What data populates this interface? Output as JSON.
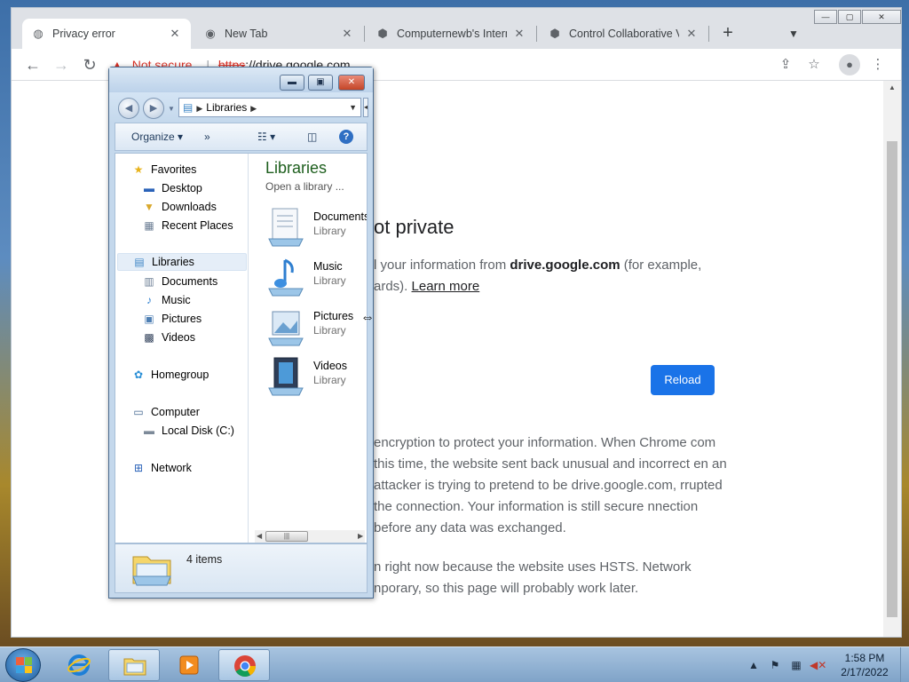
{
  "chrome": {
    "tabs": [
      {
        "label": "Privacy error",
        "icon": "globe-icon",
        "active": true
      },
      {
        "label": "New Tab",
        "icon": "chrome-icon",
        "active": false
      },
      {
        "label": "Computernewb's Interne",
        "icon": "vm-icon",
        "active": false
      },
      {
        "label": "Control Collaborative Vi",
        "icon": "vm-icon",
        "active": false
      }
    ],
    "new_tab": "+",
    "tab_search": "⌄",
    "window_controls": {
      "minimize": "—",
      "maximize": "▢",
      "close": "✕"
    },
    "url": {
      "warning": "Not secure",
      "scheme": "https",
      "host": "://drive.google.com"
    }
  },
  "page": {
    "title": "ot private",
    "para_prefix": "l your information from ",
    "para_host": "drive.google.com",
    "para_suffix": " (for example,",
    "para_line2": "ards). ",
    "learn_more": "Learn more",
    "reload": "Reload",
    "details1": "encryption to protect your information. When Chrome com this time, the website sent back unusual and incorrect en an attacker is trying to pretend to be drive.google.com, rrupted the connection. Your information is still secure nnection before any data was exchanged.",
    "details2": "n right now because the website uses HSTS. Network nporary, so this page will probably work later."
  },
  "explorer": {
    "address": "Libraries",
    "toolbar": {
      "organize": "Organize",
      "more": "»"
    },
    "nav": [
      {
        "label": "Favorites",
        "icon": "star-icon",
        "level": 0
      },
      {
        "label": "Desktop",
        "icon": "desktop-icon",
        "level": 1
      },
      {
        "label": "Downloads",
        "icon": "downloads-icon",
        "level": 1
      },
      {
        "label": "Recent Places",
        "icon": "recent-places-icon",
        "level": 1
      },
      {
        "label": "Libraries",
        "icon": "libraries-icon",
        "level": 0,
        "selected": true
      },
      {
        "label": "Documents",
        "icon": "documents-icon",
        "level": 1
      },
      {
        "label": "Music",
        "icon": "music-icon",
        "level": 1
      },
      {
        "label": "Pictures",
        "icon": "pictures-icon",
        "level": 1
      },
      {
        "label": "Videos",
        "icon": "videos-icon",
        "level": 1
      },
      {
        "label": "Homegroup",
        "icon": "homegroup-icon",
        "level": 0
      },
      {
        "label": "Computer",
        "icon": "computer-icon",
        "level": 0
      },
      {
        "label": "Local Disk (C:)",
        "icon": "disk-icon",
        "level": 1
      },
      {
        "label": "Network",
        "icon": "network-icon",
        "level": 0
      }
    ],
    "pane_title": "Libraries",
    "pane_subtitle": "Open a library ...",
    "libraries": [
      {
        "name": "Documents",
        "type": "Library"
      },
      {
        "name": "Music",
        "type": "Library"
      },
      {
        "name": "Pictures",
        "type": "Library"
      },
      {
        "name": "Videos",
        "type": "Library"
      }
    ],
    "status": "4 items"
  },
  "taskbar": {
    "clock_time": "1:58 PM",
    "clock_date": "2/17/2022"
  },
  "colors": {
    "accent": "#1a73e8",
    "warning": "#d93025",
    "explorer_title": "#1e5f1e"
  }
}
